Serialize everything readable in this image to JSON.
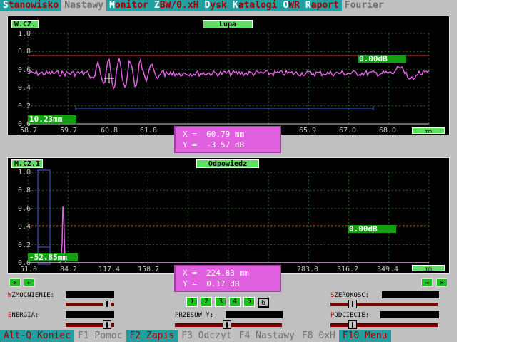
{
  "menu": [
    {
      "hot": "S",
      "rest": "tanowisko",
      "state": "active"
    },
    {
      "hot": "N",
      "rest": "astawy",
      "state": "dim"
    },
    {
      "hot": "M",
      "rest": "onitor",
      "state": "active"
    },
    {
      "hot": "Z",
      "rest": "BW/0.xH",
      "state": "active"
    },
    {
      "hot": "D",
      "rest": "ysk",
      "state": "active"
    },
    {
      "hot": "K",
      "rest": "atalogi",
      "state": "active"
    },
    {
      "hot": "O",
      "rest": "WR",
      "state": "active"
    },
    {
      "hot": "R",
      "rest": "aport",
      "state": "active"
    },
    {
      "hot": "F",
      "rest": "ourier",
      "state": "dim"
    }
  ],
  "top_panel": {
    "tag_left": "W.CZ.",
    "tag_center": "Lupa",
    "db_label": "0.00dB",
    "cursor_value": "10.23mm",
    "unit_button": "mm",
    "y_ticks": [
      "1.0",
      "0.8",
      "0.6",
      "0.4",
      "0.2",
      "0.0"
    ],
    "x_ticks": [
      "58.7",
      "59.7",
      "60.8",
      "61.8",
      "65.9",
      "67.0",
      "68.0"
    ],
    "readout_x": "X =  60.79 mm",
    "readout_y": "Y =  -3.57 dB"
  },
  "bottom_panel": {
    "tag_left": "M.CZ.I",
    "tag_center": "Odpowiedz",
    "db_label": "0.00dB",
    "cursor_value": "-52.85mm",
    "unit_button": "mm",
    "y_ticks": [
      "1.0",
      "0.8",
      "0.6",
      "0.4",
      "0.2",
      "0.0"
    ],
    "x_ticks": [
      "51.0",
      "84.2",
      "117.4",
      "150.7",
      "283.0",
      "316.2",
      "349.4"
    ],
    "readout_x": "X =  224.83 mm",
    "readout_y": "Y =  0.17 dB"
  },
  "nav": {
    "first": "«",
    "prev": "←",
    "next": "→",
    "last": "»"
  },
  "controls": {
    "wzmocnienie": {
      "hot": "W",
      "rest": "ZMOCNIENIE:"
    },
    "energia": {
      "hot": "E",
      "rest": "NERGIA:"
    },
    "szerokosc": {
      "hot": "S",
      "rest": "ZEROKOSC:"
    },
    "podciecie": {
      "hot": "P",
      "rest": "ODCIECIE:"
    },
    "przesuw": {
      "label": "PRZESUW Y:"
    },
    "number_buttons": [
      "1",
      "2",
      "3",
      "4",
      "5",
      "6"
    ],
    "selected_number": "6"
  },
  "fkeys": [
    {
      "label": "Alt-Q Koniec",
      "hl": true
    },
    {
      "label": "F1 Pomoc",
      "hl": false
    },
    {
      "label": "F2 Zapis",
      "hl": true
    },
    {
      "label": "F3 Odczyt",
      "hl": false
    },
    {
      "label": "F4 Nastawy",
      "hl": false
    },
    {
      "label": "F8 0xH",
      "hl": false
    },
    {
      "label": "F10 Menu",
      "hl": true
    }
  ],
  "colors": {
    "trace": "#e060e0",
    "grid": "#206020",
    "threshold": "#e04040",
    "window": "#4060e0",
    "accent": "#20a0a0"
  }
}
